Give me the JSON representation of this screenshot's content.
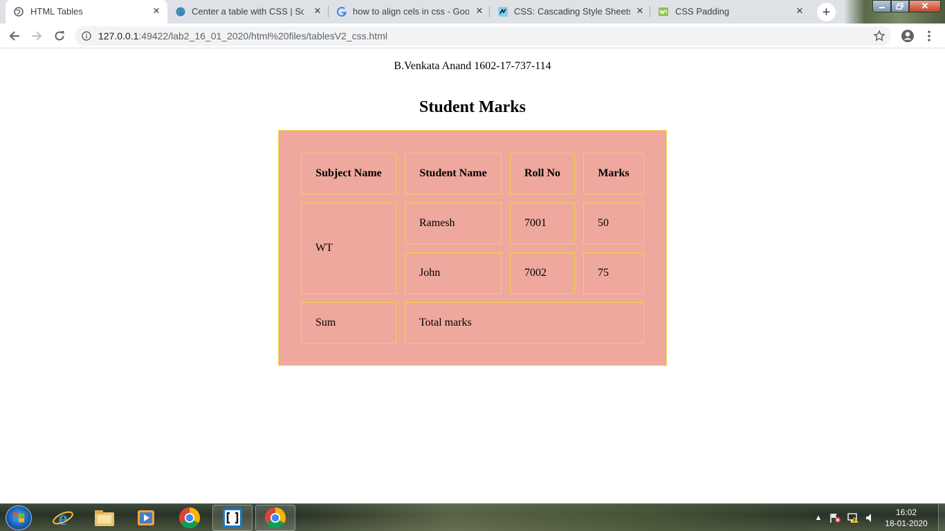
{
  "browser": {
    "tabs": [
      {
        "title": "HTML Tables",
        "icon": "globe-icon",
        "active": true
      },
      {
        "title": "Center a table with CSS | Scott G",
        "icon": "earth-icon",
        "active": false
      },
      {
        "title": "how to align cels in css - Google",
        "icon": "google-icon",
        "active": false
      },
      {
        "title": "CSS: Cascading Style Sheets | M",
        "icon": "mdn-icon",
        "active": false
      },
      {
        "title": "CSS Padding",
        "icon": "w3schools-icon",
        "active": false
      }
    ],
    "url_host": "127.0.0.1",
    "url_rest": ":49422/lab2_16_01_2020/html%20files/tablesV2_css.html"
  },
  "page": {
    "author": "B.Venkata Anand 1602-17-737-114",
    "heading": "Student Marks",
    "table": {
      "headers": [
        "Subject Name",
        "Student Name",
        "Roll No",
        "Marks"
      ],
      "subject": "WT",
      "rows": [
        {
          "student": "Ramesh",
          "roll": "7001",
          "marks": "50"
        },
        {
          "student": "John",
          "roll": "7002",
          "marks": "75"
        }
      ],
      "footer_label": "Sum",
      "footer_value": "Total marks"
    },
    "colors": {
      "table_bg": "#eea89e",
      "table_border": "#f0d640"
    }
  },
  "taskbar": {
    "apps": [
      "internet-explorer-icon",
      "file-explorer-icon",
      "media-player-icon",
      "chrome-icon",
      "brackets-icon",
      "chrome-icon"
    ],
    "time": "16:02",
    "date": "18-01-2020"
  }
}
